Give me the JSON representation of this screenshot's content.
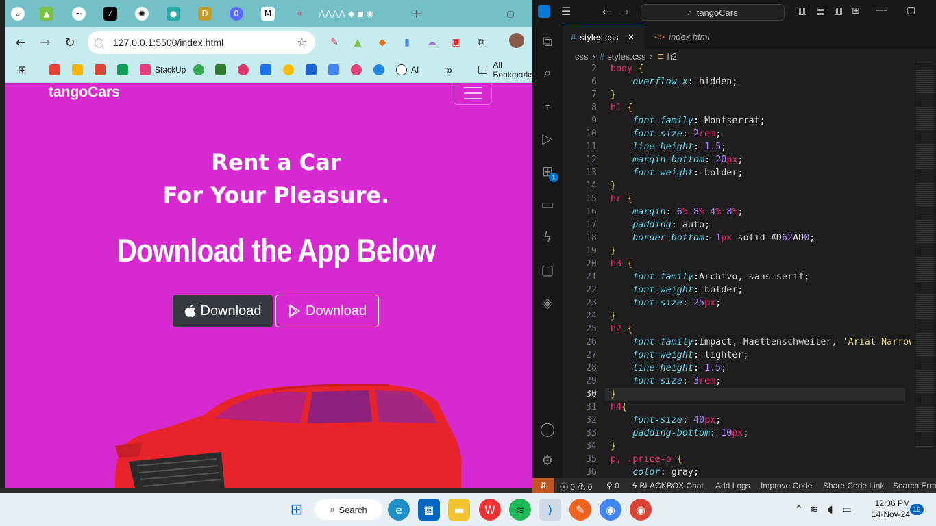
{
  "browser": {
    "url": "127.0.0.1:5500/index.html",
    "bookmarks": [
      "StackUp",
      "AI",
      "All Bookmarks"
    ]
  },
  "site": {
    "brand": "tangoCars",
    "heading_line1": "Rent a Car",
    "heading_line2": "For Your Pleasure.",
    "subheading": "Download the App Below",
    "button_apple": "Download",
    "button_play": "Download",
    "background_color": "#D62AD0"
  },
  "vscode": {
    "search": "tangoCars",
    "tabs": [
      "styles.css",
      "index.html"
    ],
    "breadcrumb": [
      "css",
      "styles.css",
      "h2"
    ],
    "status": {
      "errors": "0",
      "warnings": "0",
      "ports": "0",
      "items": [
        "BLACKBOX Chat",
        "Add Logs",
        "Improve Code",
        "Share Code Link",
        "Search Error"
      ]
    },
    "lines": [
      {
        "n": "2",
        "t": "body {"
      },
      {
        "n": "6",
        "t": "    overflow-x: hidden;"
      },
      {
        "n": "7",
        "t": "}"
      },
      {
        "n": "8",
        "t": "h1 {"
      },
      {
        "n": "9",
        "t": "    font-family: Montserrat;"
      },
      {
        "n": "10",
        "t": "    font-size: 2rem;"
      },
      {
        "n": "11",
        "t": "    line-height: 1.5;"
      },
      {
        "n": "12",
        "t": "    margin-bottom: 20px;"
      },
      {
        "n": "13",
        "t": "    font-weight: bolder;"
      },
      {
        "n": "14",
        "t": "}"
      },
      {
        "n": "15",
        "t": "hr {"
      },
      {
        "n": "16",
        "t": "    margin: 6% 8% 4% 8%;"
      },
      {
        "n": "17",
        "t": "    padding: auto;"
      },
      {
        "n": "18",
        "t": "    border-bottom: 1px solid #D62AD0;"
      },
      {
        "n": "19",
        "t": "}"
      },
      {
        "n": "20",
        "t": "h3 {"
      },
      {
        "n": "21",
        "t": "    font-family:Archivo, sans-serif;"
      },
      {
        "n": "22",
        "t": "    font-weight: bolder;"
      },
      {
        "n": "23",
        "t": "    font-size: 25px;"
      },
      {
        "n": "24",
        "t": "}"
      },
      {
        "n": "25",
        "t": "h2 {"
      },
      {
        "n": "26",
        "t": "    font-family:Impact, Haettenschweiler, 'Arial Narrow"
      },
      {
        "n": "27",
        "t": "    font-weight: lighter;"
      },
      {
        "n": "28",
        "t": "    line-height: 1.5;"
      },
      {
        "n": "29",
        "t": "    font-size: 3rem;"
      },
      {
        "n": "30",
        "t": "}"
      },
      {
        "n": "31",
        "t": "h4{"
      },
      {
        "n": "32",
        "t": "    font-size: 40px;"
      },
      {
        "n": "33",
        "t": "    padding-bottom: 10px;"
      },
      {
        "n": "34",
        "t": "}"
      },
      {
        "n": "35",
        "t": "p, .price-p {"
      },
      {
        "n": "36",
        "t": "    color: gray;"
      }
    ]
  },
  "taskbar": {
    "search": "Search",
    "time": "12:36 PM",
    "date": "14-Nov-24",
    "badge": "19"
  }
}
